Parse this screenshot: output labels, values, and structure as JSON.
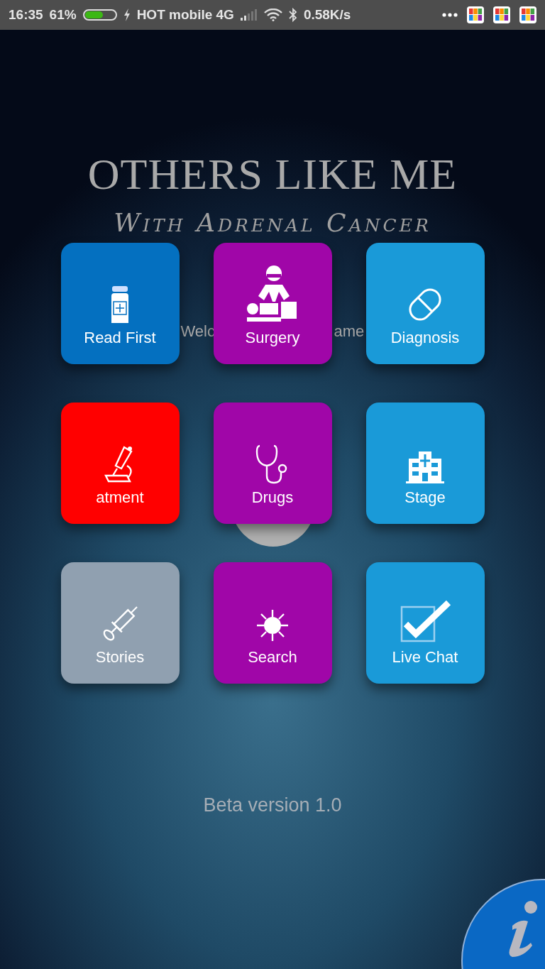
{
  "status_bar": {
    "time": "16:35",
    "battery_percent": "61%",
    "battery": {
      "level": 0.61
    },
    "carrier": "HOT mobile 4G",
    "speed": "0.58K/s"
  },
  "title": "OTHERS LIKE ME",
  "subtitle": "With Adrenal Cancer",
  "welcome_fragments": [
    "Welc",
    "ame"
  ],
  "tiles": [
    {
      "label": "Read First",
      "color": "#0470c0",
      "kind": "bottle"
    },
    {
      "label": "Surgery",
      "color": "#a006a8",
      "kind": "surgeon"
    },
    {
      "label": "Diagnosis",
      "color": "#1a9ad8",
      "kind": "pill"
    },
    {
      "label": "atment",
      "color": "#ff0000",
      "kind": "microscope"
    },
    {
      "label": "Drugs",
      "color": "#a006a8",
      "kind": "stethoscope"
    },
    {
      "label": "Stage",
      "color": "#1a9ad8",
      "kind": "hospital"
    },
    {
      "label": "Stories",
      "color": "#90a0b0",
      "kind": "syringe"
    },
    {
      "label": "Search",
      "color": "#a006a8",
      "kind": "virus"
    },
    {
      "label": "Live Chat",
      "color": "#1a9ad8",
      "kind": "checkbox"
    }
  ],
  "version": "Beta version 1.0"
}
